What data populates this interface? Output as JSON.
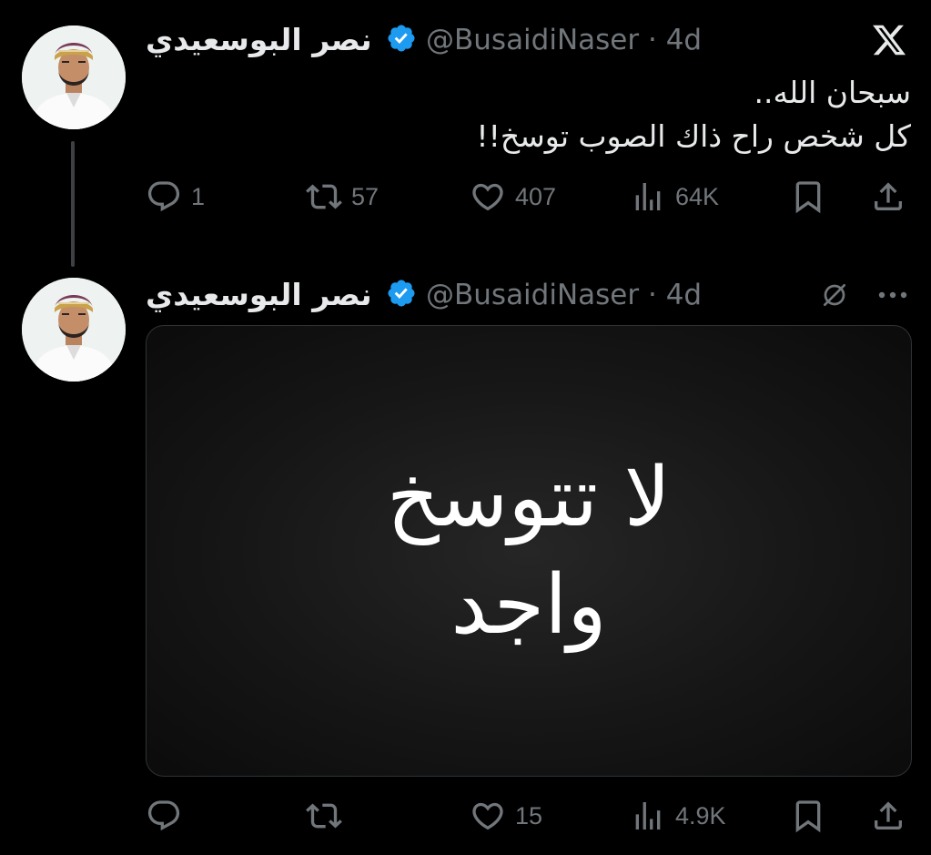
{
  "tweets": [
    {
      "author_name": "نصر البوسعيدي",
      "handle": "@BusaidiNaser",
      "time": "4d",
      "text_line_1": "سبحان الله..",
      "text_line_2": "كل شخص راح ذاك الصوب توسخ!!",
      "replies": "1",
      "retweets": "57",
      "likes": "407",
      "views": "64K",
      "icons": [
        "x-logo",
        "verified-badge",
        "reply-icon",
        "retweet-icon",
        "like-icon",
        "views-icon",
        "bookmark-icon",
        "share-icon"
      ]
    },
    {
      "author_name": "نصر البوسعيدي",
      "handle": "@BusaidiNaser",
      "time": "4d",
      "media_text_line_1": "لا تتوسخ",
      "media_text_line_2": "واجد",
      "replies": "",
      "retweets": "",
      "likes": "15",
      "views": "4.9K",
      "icons": [
        "grok-icon",
        "more-icon",
        "verified-badge",
        "reply-icon",
        "retweet-icon",
        "like-icon",
        "views-icon",
        "bookmark-icon",
        "share-icon"
      ]
    }
  ],
  "colors": {
    "background": "#000000",
    "text_primary": "#e7e9ea",
    "text_secondary": "#71767b",
    "verified_blue": "#1d9bf0",
    "thread_line": "#3e4144"
  }
}
